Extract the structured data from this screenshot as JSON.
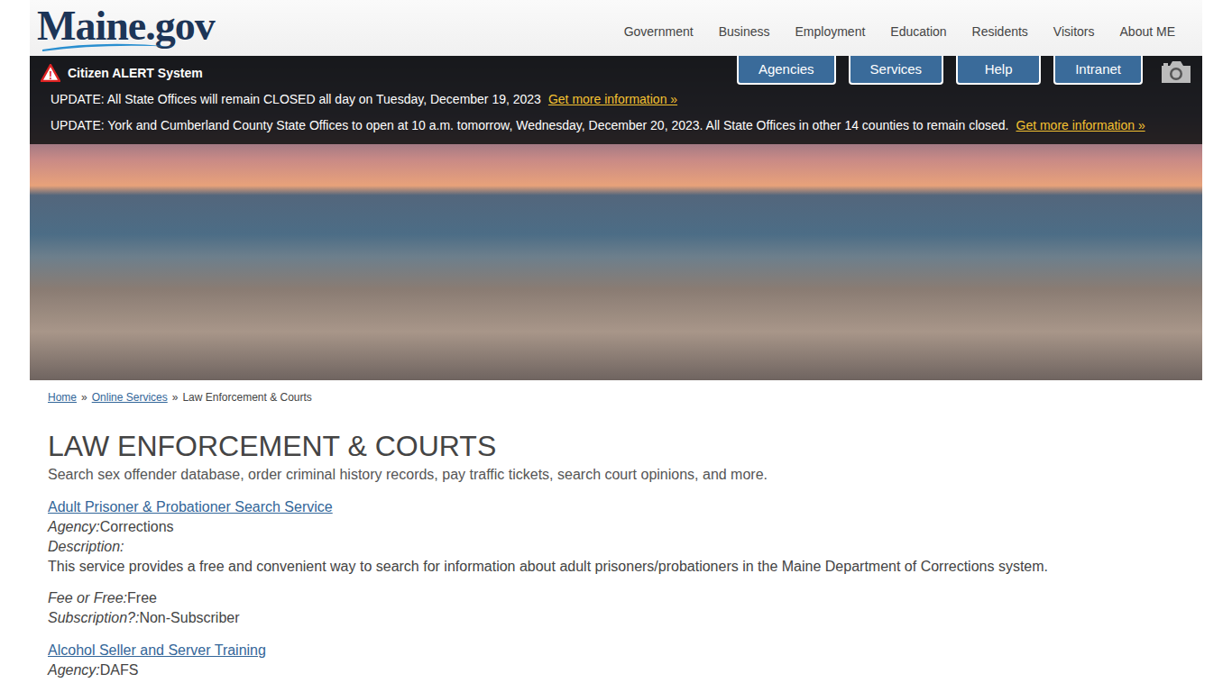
{
  "logo": "Maine.gov",
  "nav": [
    "Government",
    "Business",
    "Employment",
    "Education",
    "Residents",
    "Visitors",
    "About ME"
  ],
  "alert": {
    "icon": "!",
    "title": "Citizen ALERT System",
    "updates": [
      {
        "text": "UPDATE: All State Offices will remain CLOSED all day on Tuesday, December 19, 2023",
        "link": "Get more information »"
      },
      {
        "text": "UPDATE: York and Cumberland County State Offices to open at 10 a.m. tomorrow, Wednesday, December 20, 2023. All State Offices in other 14 counties to remain closed.",
        "link": "Get more information »"
      }
    ]
  },
  "quick_buttons": [
    "Agencies",
    "Services",
    "Help",
    "Intranet"
  ],
  "breadcrumb": {
    "separator": "»",
    "items": [
      {
        "label": "Home",
        "link": true
      },
      {
        "label": "Online Services",
        "link": true
      },
      {
        "label": "Law Enforcement & Courts",
        "link": false
      }
    ]
  },
  "page": {
    "title": "LAW ENFORCEMENT & COURTS",
    "description": "Search sex offender database, order criminal history records, pay traffic tickets, search court opinions, and more."
  },
  "services": [
    {
      "name": "Adult Prisoner & Probationer Search Service",
      "groups": [
        [
          {
            "label": "Agency:",
            "value": "Corrections"
          },
          {
            "label": "Description:"
          },
          {
            "value": "This service provides a free and convenient way to search for information about adult prisoners/probationers in the Maine Department of Corrections system."
          }
        ],
        [
          {
            "label": "Fee or Free:",
            "value": "Free"
          },
          {
            "label": "Subscription?:",
            "value": "Non-Subscriber"
          }
        ]
      ]
    },
    {
      "name": "Alcohol Seller and Server Training",
      "groups": [
        [
          {
            "label": "Agency:",
            "value": "DAFS"
          }
        ]
      ]
    }
  ]
}
